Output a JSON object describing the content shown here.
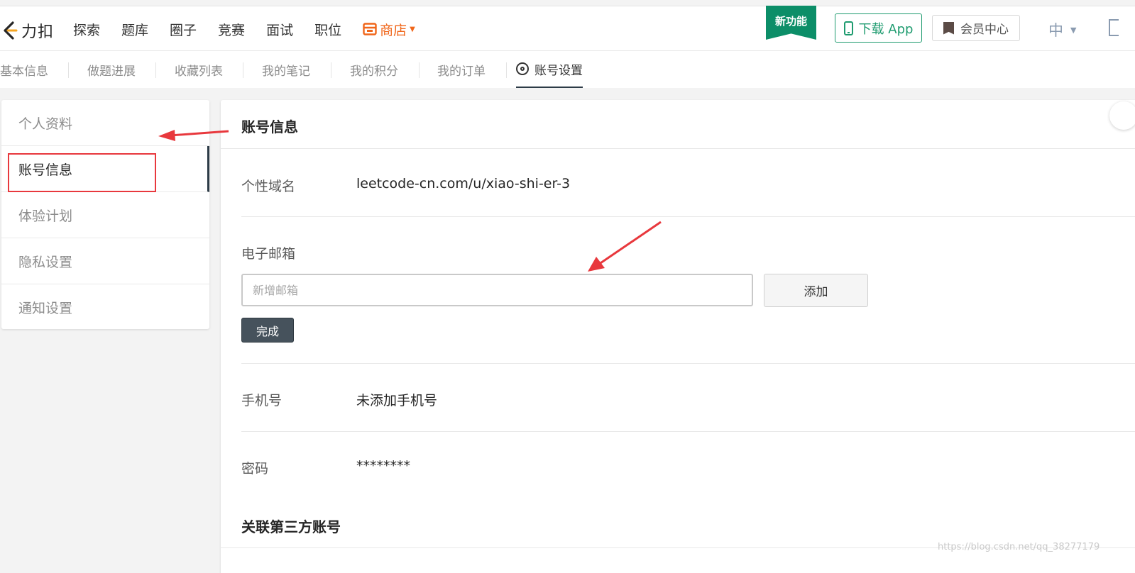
{
  "nav": {
    "logo_text": "力扣",
    "items": [
      "探索",
      "题库",
      "圈子",
      "竞赛",
      "面试",
      "职位"
    ],
    "shop_label": "商店",
    "new_feature_badge": "新功能",
    "download_label": "下载 App",
    "member_label": "会员中心",
    "lang_label": "中"
  },
  "subtabs": {
    "items": [
      "基本信息",
      "做题进展",
      "收藏列表",
      "我的笔记",
      "我的积分",
      "我的订单",
      "账号设置"
    ],
    "active_index": 6
  },
  "sidebar": {
    "items": [
      "个人资料",
      "账号信息",
      "体验计划",
      "隐私设置",
      "通知设置"
    ],
    "active_index": 1
  },
  "main": {
    "title": "账号信息",
    "domain_label": "个性域名",
    "domain_value": "leetcode-cn.com/u/xiao-shi-er-3",
    "email_label": "电子邮箱",
    "email_placeholder": "新增邮箱",
    "add_button": "添加",
    "done_button": "完成",
    "phone_label": "手机号",
    "phone_value": "未添加手机号",
    "password_label": "密码",
    "password_value": "********",
    "third_party_title": "关联第三方账号"
  },
  "watermark": "https://blog.csdn.net/qq_38277179",
  "colors": {
    "accent_green": "#0c8e68",
    "shop_orange": "#f0661a",
    "annotation_red": "#e8383d",
    "dark_button": "#46525c"
  }
}
